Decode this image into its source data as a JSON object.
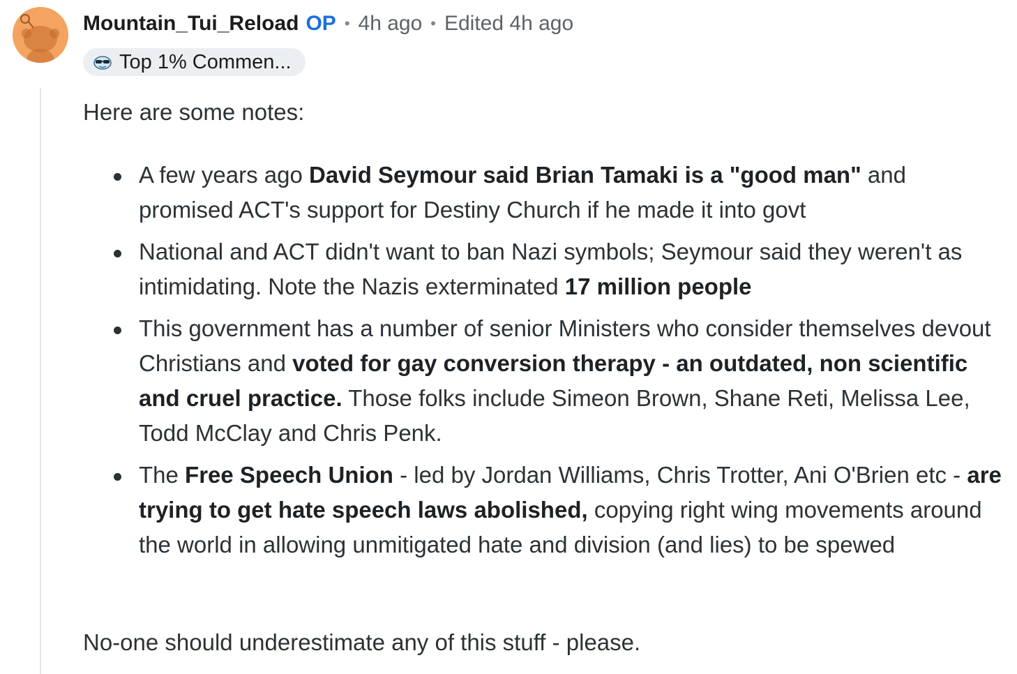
{
  "comment": {
    "username": "Mountain_Tui_Reload",
    "op_badge": "OP",
    "separator": "•",
    "timestamp": "4h ago",
    "edited": "Edited 4h ago",
    "flair": "Top 1% Commen...",
    "intro": "Here are some notes:",
    "bullets": [
      {
        "t1": "A few years ago ",
        "b1": "David Seymour said Brian Tamaki is a \"good man\"",
        "t2": " and promised ACT's support for Destiny Church if he made it into govt"
      },
      {
        "t1": "National and ACT didn't want to ban Nazi symbols; Seymour said they weren't as intimidating. Note the Nazis exterminated ",
        "b1": "17 million people",
        "t2": ""
      },
      {
        "t1": "This government has a number of senior Ministers who consider themselves devout Christians and ",
        "b1": "voted for gay conversion therapy - an outdated, non scientific and cruel practice.",
        "t2": " Those folks include Simeon Brown, Shane Reti, Melissa Lee, Todd McClay and Chris Penk."
      },
      {
        "t1": "The ",
        "b1": "Free Speech Union",
        "t2": " - led by Jordan Williams, Chris Trotter, Ani O'Brien etc - ",
        "b2": "are trying to get hate speech laws abolished,",
        "t3": " copying right wing movements around the world in allowing unmitigated hate and division (and lies) to be spewed"
      }
    ],
    "outro": "No-one should underestimate any of this stuff - please."
  },
  "colors": {
    "avatar_bg": "#f4a460",
    "op_blue": "#1d6fd8",
    "text": "#2a3236"
  },
  "icons": {
    "avatar": "reddit-snoo-avatar",
    "flair": "sunglasses-flair-icon"
  }
}
